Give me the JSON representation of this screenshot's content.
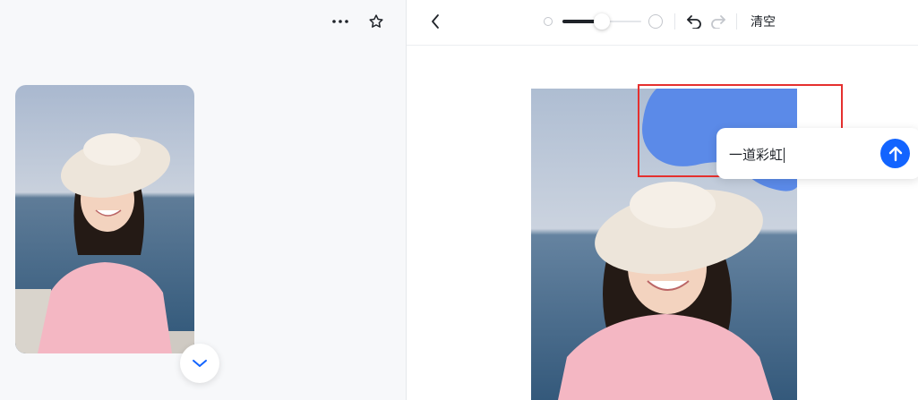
{
  "left": {
    "more_icon": "more-horizontal-icon",
    "favorite_icon": "star-outline-icon",
    "thumbnail_alt": "",
    "scroll_down_icon": "chevron-down-icon"
  },
  "toolbar": {
    "back_icon": "chevron-left-icon",
    "brush_size_level": 0.5,
    "undo_icon": "undo-icon",
    "redo_icon": "redo-icon",
    "clear_label": "清空"
  },
  "prompt": {
    "value": "一道彩虹",
    "send_icon": "arrow-up-icon"
  },
  "colors": {
    "accent": "#1264ff",
    "mask": "#5b8ae8",
    "selection": "#e5302f"
  }
}
